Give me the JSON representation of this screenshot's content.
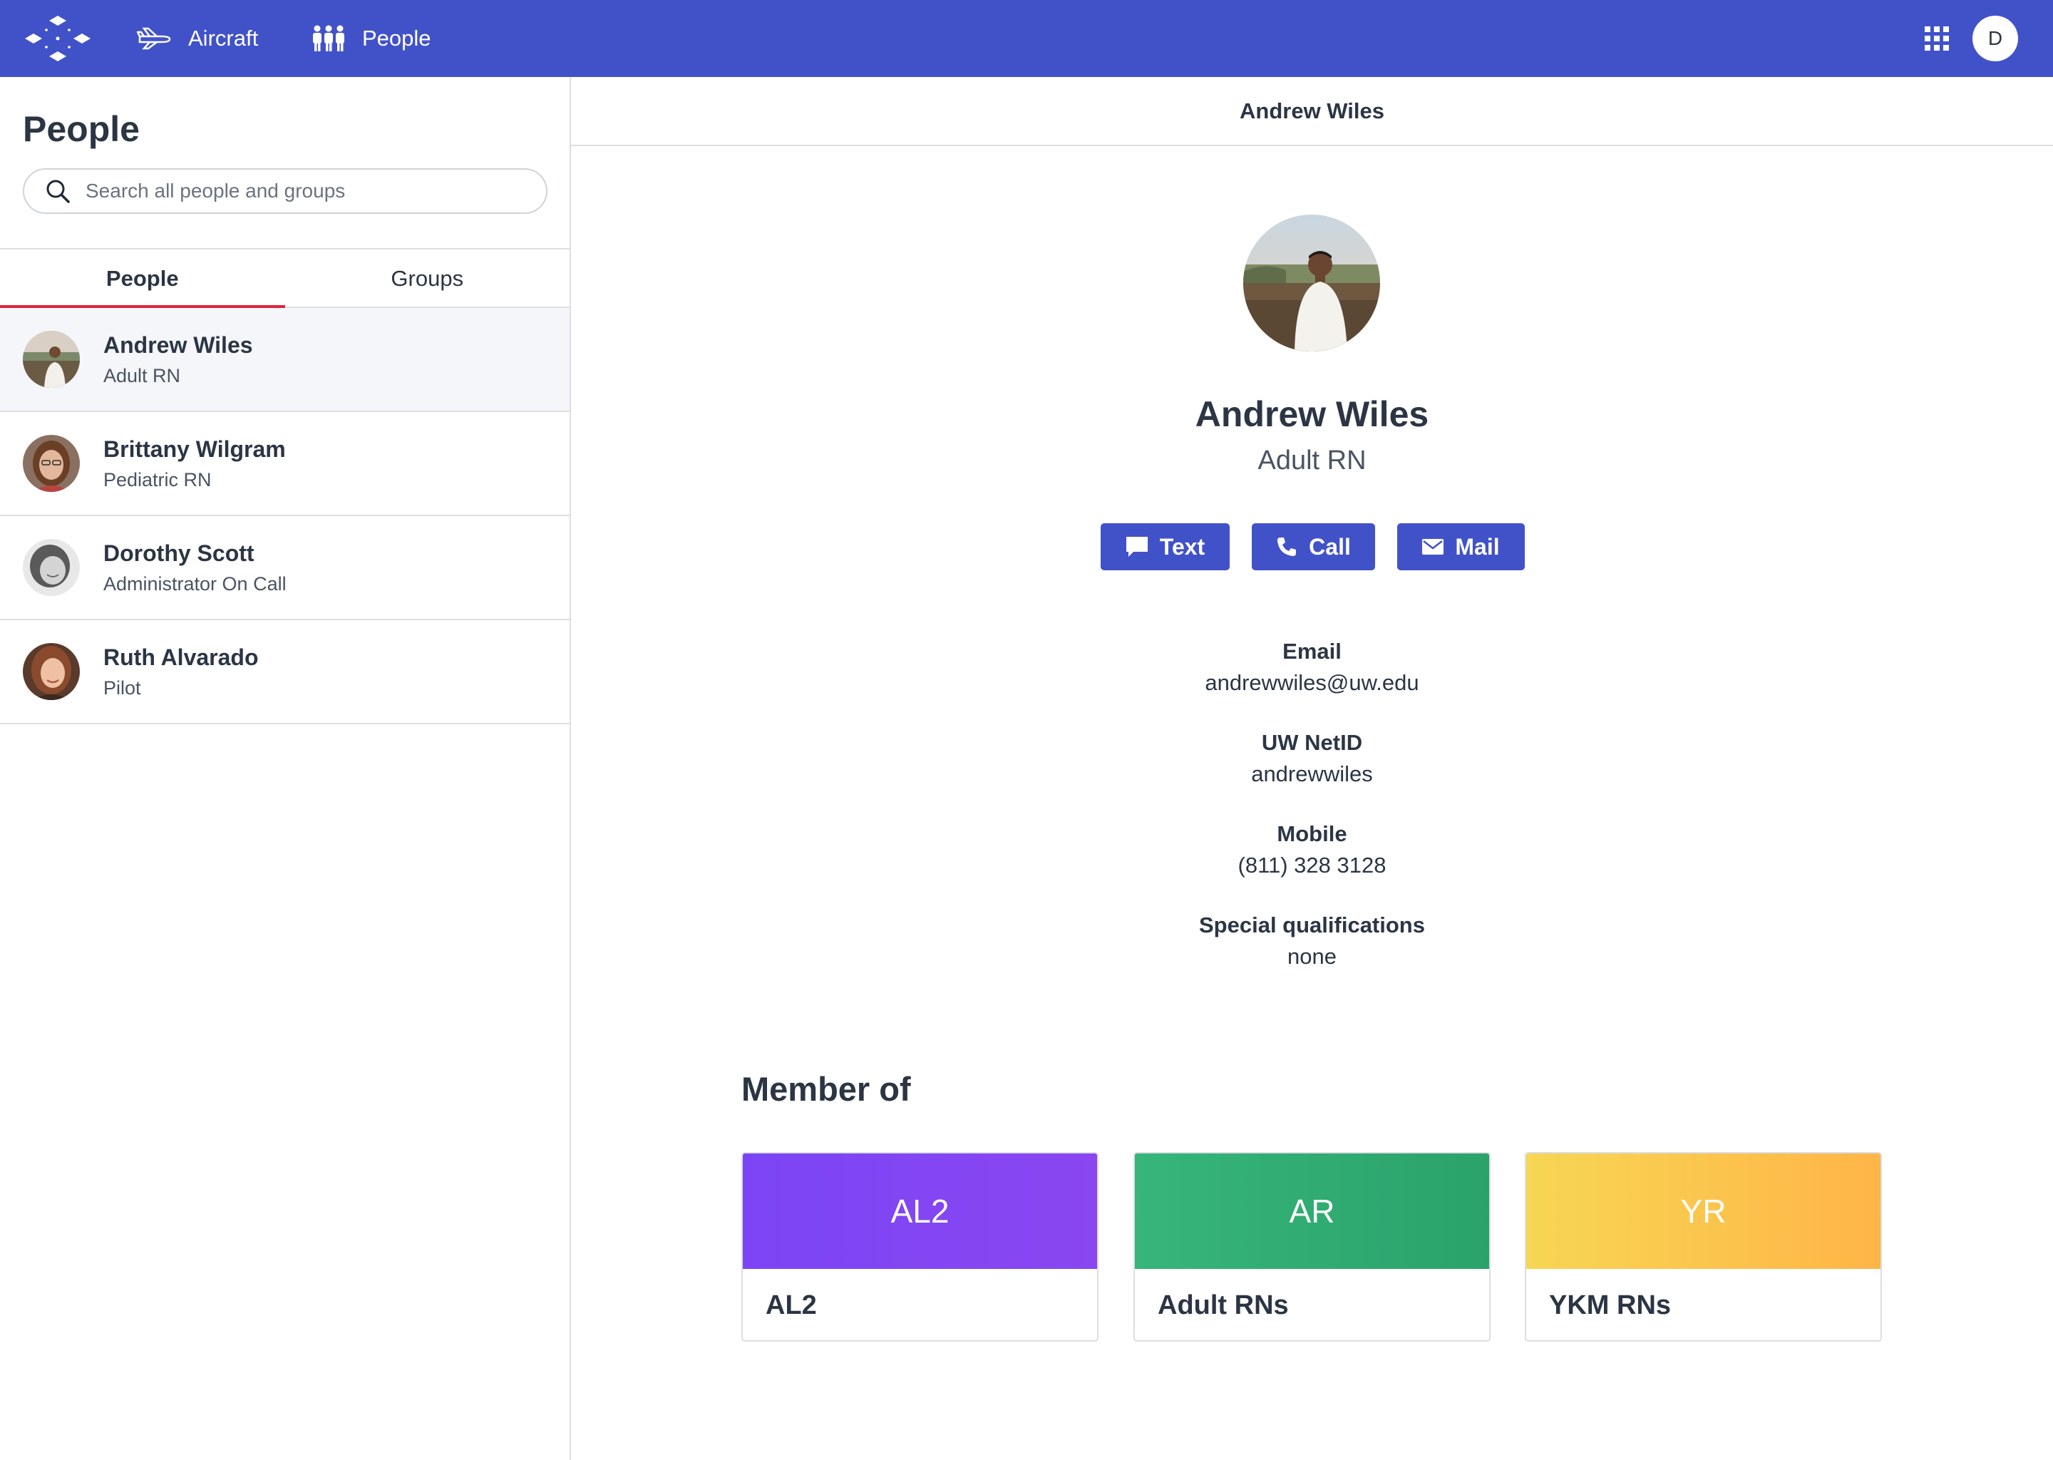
{
  "topbar": {
    "nav": [
      {
        "label": "Aircraft",
        "icon": "plane-icon"
      },
      {
        "label": "People",
        "icon": "people-icon"
      }
    ],
    "user_initial": "D",
    "accent_color": "#4152c9"
  },
  "left_panel": {
    "title": "People",
    "search_placeholder": "Search all people and groups",
    "tabs": [
      {
        "label": "People",
        "active": true
      },
      {
        "label": "Groups",
        "active": false
      }
    ],
    "people": [
      {
        "name": "Andrew Wiles",
        "role": "Adult RN",
        "selected": true
      },
      {
        "name": "Brittany Wilgram",
        "role": "Pediatric RN",
        "selected": false
      },
      {
        "name": "Dorothy Scott",
        "role": "Administrator On Call",
        "selected": false
      },
      {
        "name": "Ruth Alvarado",
        "role": "Pilot",
        "selected": false
      }
    ]
  },
  "detail": {
    "header": "Andrew Wiles",
    "name": "Andrew Wiles",
    "role": "Adult RN",
    "actions": [
      {
        "label": "Text",
        "icon": "chat-icon"
      },
      {
        "label": "Call",
        "icon": "phone-icon"
      },
      {
        "label": "Mail",
        "icon": "mail-icon"
      }
    ],
    "fields": [
      {
        "label": "Email",
        "value": "andrewwiles@uw.edu"
      },
      {
        "label": "UW NetID",
        "value": "andrewwiles"
      },
      {
        "label": "Mobile",
        "value": "(811) 328 3128"
      },
      {
        "label": "Special qualifications",
        "value": "none"
      }
    ],
    "member_of_title": "Member of",
    "groups": [
      {
        "abbr": "AL2",
        "name": "AL2",
        "color_start": "#7b45f5",
        "color_end": "#8a46f0"
      },
      {
        "abbr": "AR",
        "name": "Adult RNs",
        "color_start": "#37b57a",
        "color_end": "#2aa36b"
      },
      {
        "abbr": "YR",
        "name": "YKM RNs",
        "color_start": "#f7d654",
        "color_end": "#ffb547"
      }
    ]
  }
}
